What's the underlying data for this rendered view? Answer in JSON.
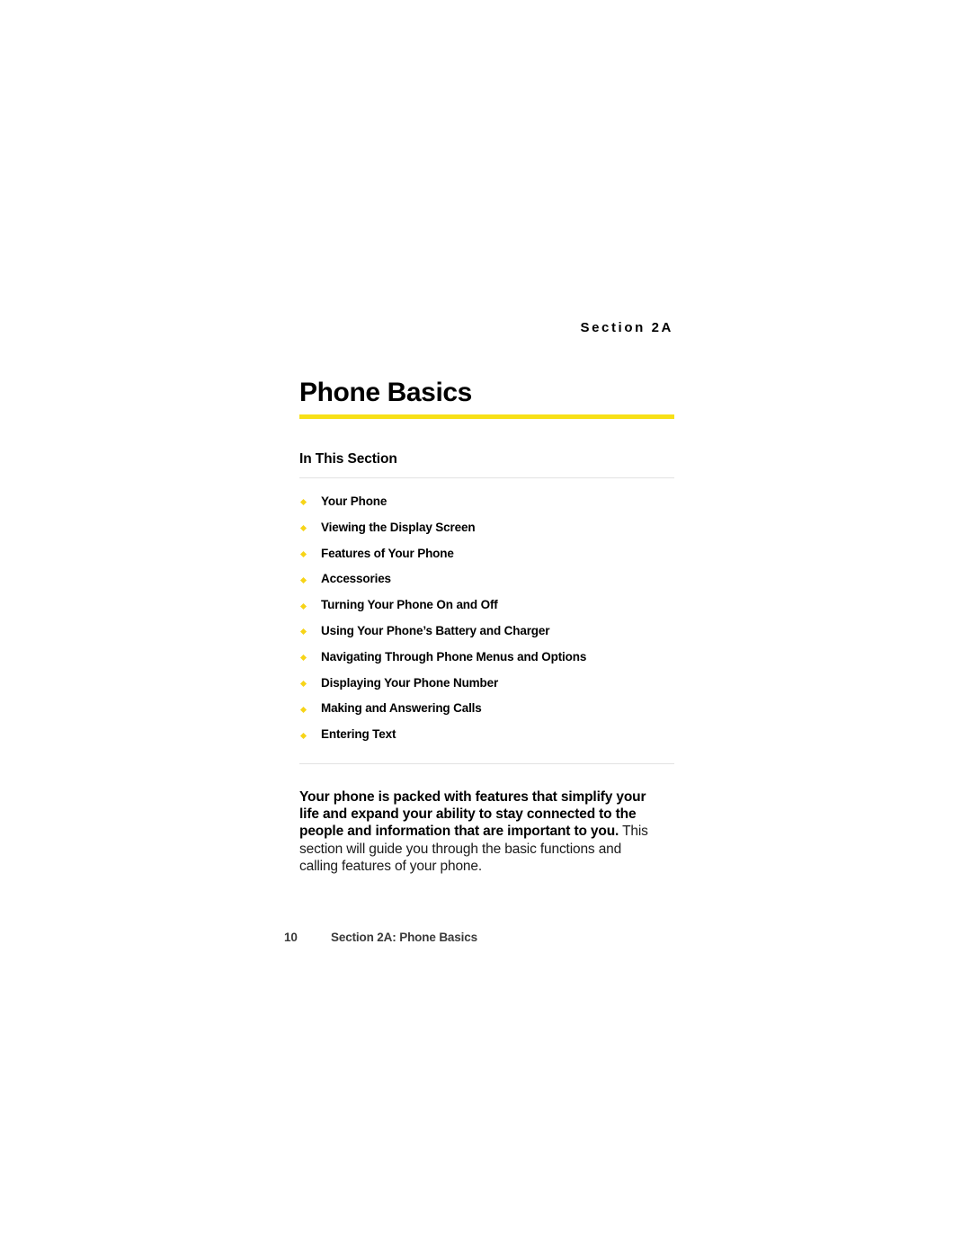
{
  "section_label": "Section 2A",
  "title": "Phone Basics",
  "in_this_section_heading": "In This Section",
  "toc_items": [
    {
      "label": "Your Phone"
    },
    {
      "label": "Viewing the Display Screen"
    },
    {
      "label": "Features of Your Phone"
    },
    {
      "label": "Accessories"
    },
    {
      "label": "Turning Your Phone On and Off"
    },
    {
      "label": "Using Your Phone’s Battery and Charger"
    },
    {
      "label": "Navigating Through Phone Menus and Options"
    },
    {
      "label": "Displaying Your Phone Number"
    },
    {
      "label": "Making and Answering Calls"
    },
    {
      "label": "Entering Text"
    }
  ],
  "intro": {
    "lead": "Your phone is packed with features that simplify your life and expand your ability to stay connected to the people and information that are important to you.",
    "rest": " This section will guide you through the basic functions and calling features of your phone."
  },
  "footer": {
    "page_number": "10",
    "text": "Section 2A: Phone Basics"
  },
  "colors": {
    "accent_yellow": "#f7e017",
    "bullet_yellow": "#f7d417",
    "hairline_gray": "#e2e2e2",
    "footer_gray": "#3a3a3a",
    "text_black": "#000000"
  }
}
